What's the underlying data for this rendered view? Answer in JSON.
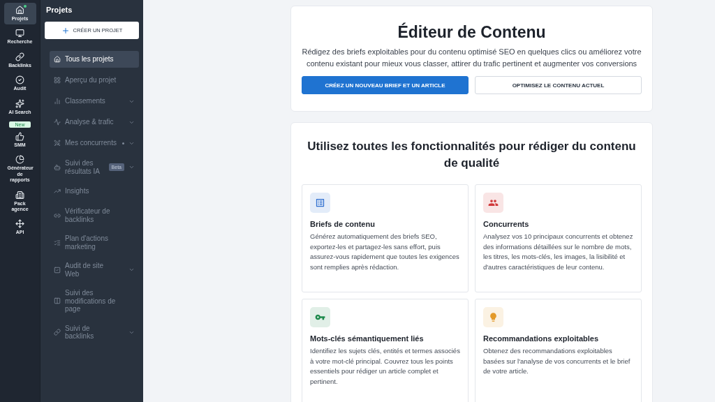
{
  "rail": [
    {
      "label": "Projets",
      "selected": true,
      "dot": true
    },
    {
      "label": "Recherche",
      "selected": false
    },
    {
      "label": "Backlinks",
      "selected": false
    },
    {
      "label": "Audit",
      "selected": false
    },
    {
      "label": "AI Search",
      "selected": false,
      "badge": "New"
    },
    {
      "label": "SMM",
      "selected": false
    },
    {
      "label": "Générateur de rapports",
      "selected": false
    },
    {
      "label": "Pack agence",
      "selected": false
    },
    {
      "label": "API",
      "selected": false
    }
  ],
  "nav": {
    "title": "Projets",
    "create_button": "CRÉER UN PROJET",
    "items": [
      {
        "label": "Tous les projets",
        "selected": true,
        "expandable": false
      },
      {
        "label": "Aperçu du projet",
        "selected": false,
        "expandable": false
      },
      {
        "label": "Classements",
        "selected": false,
        "expandable": true
      },
      {
        "label": "Analyse & trafic",
        "selected": false,
        "expandable": true
      },
      {
        "label": "Mes concurrents",
        "selected": false,
        "expandable": true,
        "dot": true
      },
      {
        "label": "Suivi des résultats IA",
        "selected": false,
        "expandable": true,
        "badge": "Beta"
      },
      {
        "label": "Insights",
        "selected": false,
        "expandable": false
      },
      {
        "label": "Vérificateur de backlinks",
        "selected": false,
        "expandable": false
      },
      {
        "label": "Plan d'actions marketing",
        "selected": false,
        "expandable": false
      },
      {
        "label": "Audit de site Web",
        "selected": false,
        "expandable": true
      },
      {
        "label": "Suivi des modifications de page",
        "selected": false,
        "expandable": false
      },
      {
        "label": "Suivi de backlinks",
        "selected": false,
        "expandable": true
      }
    ]
  },
  "hero": {
    "title": "Éditeur de Contenu",
    "description": "Rédigez des briefs exploitables pour du contenu optimisé SEO en quelques clics ou améliorez votre contenu existant pour mieux vous classer, attirer du trafic pertinent et augmenter vos conversions",
    "buttons": [
      {
        "label": "CRÉEZ UN NOUVEAU BRIEF ET UN ARTICLE",
        "kind": "primary"
      },
      {
        "label": "OPTIMISEZ LE CONTENU ACTUEL",
        "kind": "secondary"
      }
    ]
  },
  "features": {
    "title": "Utilisez toutes les fonctionnalités pour rédiger du contenu de qualité",
    "cards": [
      {
        "title": "Briefs de contenu",
        "text": "Générez automatiquement des briefs SEO, exportez-les et partagez-les sans effort, puis assurez-vous rapidement que toutes les exigences sont remplies après rédaction.",
        "color": "#2f6fd0"
      },
      {
        "title": "Concurrents",
        "text": "Analysez vos 10 principaux concurrents et obtenez des informations détaillées sur le nombre de mots, les titres, les mots-clés, les images, la lisibilité et d'autres caractéristiques de leur contenu.",
        "color": "#d0393b"
      },
      {
        "title": "Mots-clés sémantiquement liés",
        "text": "Identifiez les sujets clés, entités et termes associés à votre mot-clé principal. Couvrez tous les points essentiels pour rédiger un article complet et pertinent.",
        "color": "#1e8a4c"
      },
      {
        "title": "Recommandations exploitables",
        "text": "Obtenez des recommandations exploitables basées sur l'analyse de vos concurrents et le brief de votre article.",
        "color": "#e39a2a"
      }
    ]
  }
}
